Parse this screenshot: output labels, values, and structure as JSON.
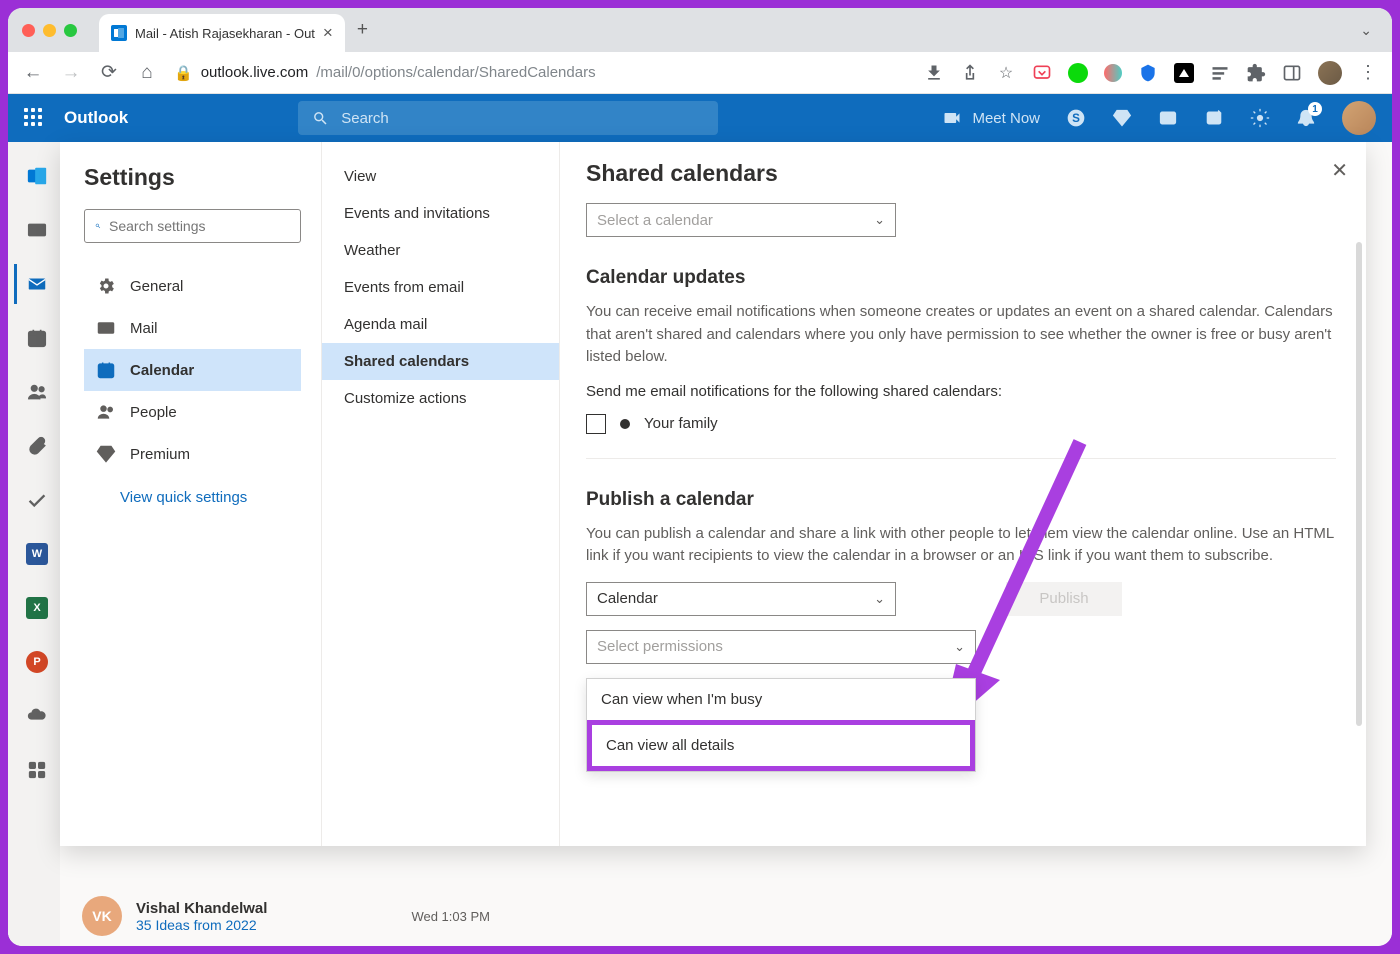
{
  "browser": {
    "tab_title": "Mail - Atish Rajasekharan - Out",
    "url_host": "outlook.live.com",
    "url_path": "/mail/0/options/calendar/SharedCalendars"
  },
  "outlook_header": {
    "brand": "Outlook",
    "search_placeholder": "Search",
    "meet_now": "Meet Now",
    "notification_badge": "1"
  },
  "settings": {
    "title": "Settings",
    "search_placeholder": "Search settings",
    "categories": [
      {
        "label": "General",
        "icon": "gear"
      },
      {
        "label": "Mail",
        "icon": "mail"
      },
      {
        "label": "Calendar",
        "icon": "calendar",
        "selected": true
      },
      {
        "label": "People",
        "icon": "people"
      },
      {
        "label": "Premium",
        "icon": "diamond"
      }
    ],
    "quick_settings": "View quick settings",
    "subcategories": [
      "View",
      "Events and invitations",
      "Weather",
      "Events from email",
      "Agenda mail",
      "Shared calendars",
      "Customize actions"
    ],
    "selected_subcategory": "Shared calendars"
  },
  "panel": {
    "title": "Shared calendars",
    "select_calendar_placeholder": "Select a calendar",
    "updates": {
      "heading": "Calendar updates",
      "description": "You can receive email notifications when someone creates or updates an event on a shared calendar. Calendars that aren't shared and calendars where you only have permission to see whether the owner is free or busy aren't listed below.",
      "send_me_label": "Send me email notifications for the following shared calendars:",
      "family_item": "Your family"
    },
    "publish": {
      "heading": "Publish a calendar",
      "description": "You can publish a calendar and share a link with other people to let them view the calendar online. Use an HTML link if you want recipients to view the calendar in a browser or an ICS link if you want them to subscribe.",
      "calendar_value": "Calendar",
      "permissions_placeholder": "Select permissions",
      "button": "Publish",
      "options": [
        "Can view when I'm busy",
        "Can view all details"
      ]
    }
  },
  "mail_preview": {
    "avatar": "VK",
    "sender": "Vishal Khandelwal",
    "subject": "35 Ideas from 2022",
    "time": "Wed 1:03 PM"
  }
}
